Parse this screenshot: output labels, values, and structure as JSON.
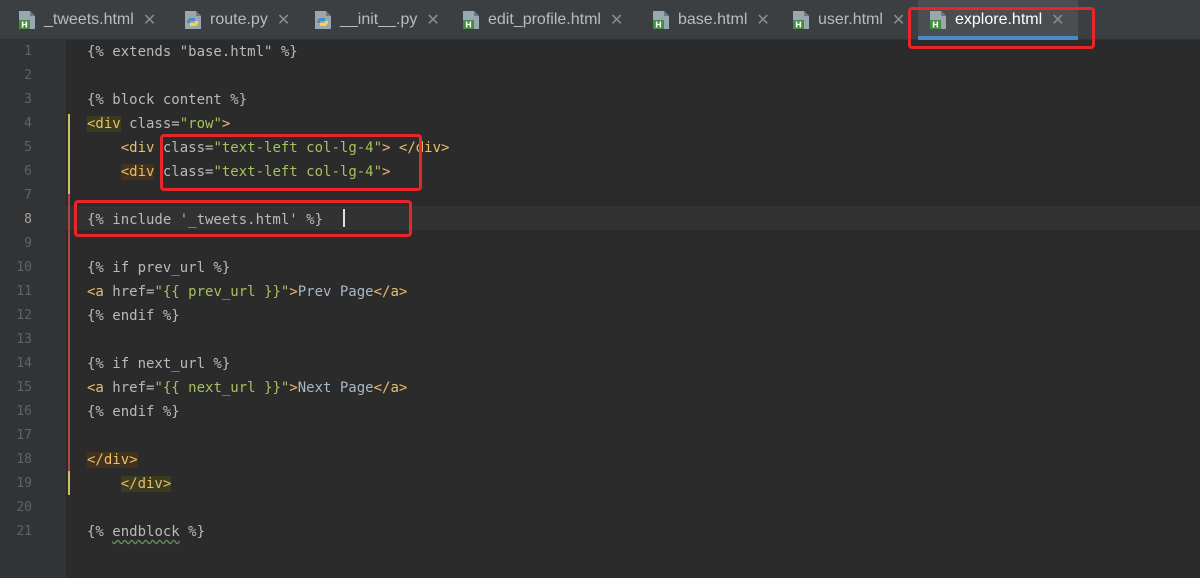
{
  "tabs": [
    {
      "label": "_tweets.html",
      "icon": "html-file-icon",
      "active": false
    },
    {
      "label": "route.py",
      "icon": "python-file-icon",
      "active": false
    },
    {
      "label": "__init__.py",
      "icon": "python-file-icon",
      "active": false
    },
    {
      "label": "edit_profile.html",
      "icon": "html-file-icon",
      "active": false
    },
    {
      "label": "base.html",
      "icon": "html-file-icon",
      "active": false
    },
    {
      "label": "user.html",
      "icon": "html-file-icon",
      "active": false
    },
    {
      "label": "explore.html",
      "icon": "html-file-icon",
      "active": true
    }
  ],
  "close_glyph": "✕",
  "editor": {
    "current_line": 8,
    "line_numbers": [
      "1",
      "2",
      "3",
      "4",
      "5",
      "6",
      "7",
      "8",
      "9",
      "10",
      "11",
      "12",
      "13",
      "14",
      "15",
      "16",
      "17",
      "18",
      "19",
      "20",
      "21"
    ],
    "lines": {
      "l1": "{% extends \"base.html\" %}",
      "l3": "{% block content %}",
      "l4_tag": "<div",
      "l4_attr": " class=",
      "l4_str": "\"row\"",
      "l4_close": ">",
      "l5_indent": "    ",
      "l5_tag": "<div",
      "l5_attr": " class=",
      "l5_str": "\"text-left col-lg-4\"",
      "l5_close": ">",
      "l5_end": " </div>",
      "l6_indent": "    ",
      "l6_tag": "<div",
      "l6_attr": " class=",
      "l6_str": "\"text-left col-lg-4\"",
      "l6_close": ">",
      "l8": "{% include '_tweets.html' %}",
      "l10": "{% if prev_url %}",
      "l11_tag": "<a",
      "l11_attr": " href=",
      "l11_str": "\"{{ prev_url }}\"",
      "l11_close": ">",
      "l11_text": "Prev Page",
      "l11_end": "</a>",
      "l12": "{% endif %}",
      "l14": "{% if next_url %}",
      "l15_tag": "<a",
      "l15_attr": " href=",
      "l15_str": "\"{{ next_url }}\"",
      "l15_close": ">",
      "l15_text": "Next Page",
      "l15_end": "</a>",
      "l16": "{% endif %}",
      "l18": "</div>",
      "l19_indent": "    ",
      "l19": "</div>",
      "l21_pre": "{% ",
      "l21_kw": "endblock",
      "l21_post": " %}"
    }
  },
  "colors": {
    "highlight_box": "#e8262a",
    "active_tab_underline": "#4a88c7",
    "tag": "#e8bf6a",
    "string": "#a5c25c"
  }
}
